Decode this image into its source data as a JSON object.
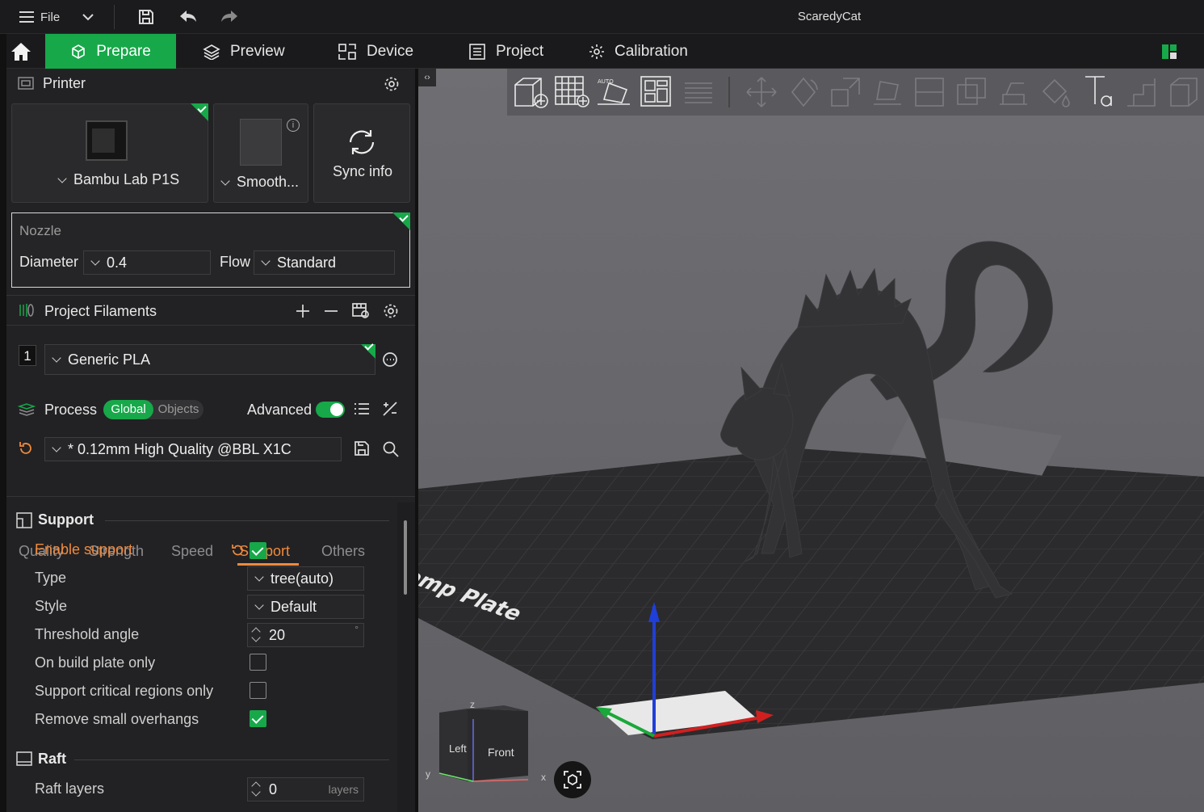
{
  "titlebar": {
    "menu_label": "File",
    "app_title": "ScaredyCat",
    "icons": [
      "menu-icon",
      "chevron-down-icon",
      "save-icon",
      "undo-icon",
      "redo-icon"
    ]
  },
  "tabs": [
    {
      "label": "Prepare",
      "icon": "cube-icon",
      "active": true
    },
    {
      "label": "Preview",
      "icon": "layers-icon",
      "active": false
    },
    {
      "label": "Device",
      "icon": "device-icon",
      "active": false
    },
    {
      "label": "Project",
      "icon": "list-icon",
      "active": false
    },
    {
      "label": "Calibration",
      "icon": "gear-icon",
      "active": false
    }
  ],
  "printer": {
    "section_title": "Printer",
    "printer_name": "Bambu Lab P1S",
    "plate_name": "Smooth...",
    "sync_label": "Sync info",
    "nozzle": {
      "title": "Nozzle",
      "diameter_label": "Diameter",
      "diameter_value": "0.4",
      "flow_label": "Flow",
      "flow_value": "Standard"
    }
  },
  "filaments": {
    "section_title": "Project Filaments",
    "items": [
      {
        "index": "1",
        "name": "Generic PLA"
      }
    ]
  },
  "process": {
    "section_title": "Process",
    "toggle_global": "Global",
    "toggle_objects": "Objects",
    "advanced_label": "Advanced",
    "advanced_on": true,
    "preset": "* 0.12mm High Quality @BBL X1C",
    "tabs": [
      "Quality",
      "Strength",
      "Speed",
      "Support",
      "Others"
    ],
    "active_tab": "Support",
    "support": {
      "group_title": "Support",
      "enable_label": "Enable support",
      "enable_checked": true,
      "type_label": "Type",
      "type_value": "tree(auto)",
      "style_label": "Style",
      "style_value": "Default",
      "threshold_label": "Threshold angle",
      "threshold_value": "20",
      "threshold_unit": "°",
      "build_plate_label": "On build plate only",
      "build_plate_checked": false,
      "critical_label": "Support critical regions only",
      "critical_checked": false,
      "overhangs_label": "Remove small overhangs",
      "overhangs_checked": true
    },
    "raft": {
      "group_title": "Raft",
      "layers_label": "Raft layers",
      "layers_value": "0",
      "layers_unit": "layers"
    }
  },
  "viewport": {
    "plate_text": "Smooth High Temp Plate",
    "cube_labels": {
      "left": "Left",
      "front": "Front",
      "z": "z",
      "y": "y",
      "x": "x"
    }
  },
  "colors": {
    "accent": "#17a84a",
    "highlight": "#f08a3c"
  }
}
